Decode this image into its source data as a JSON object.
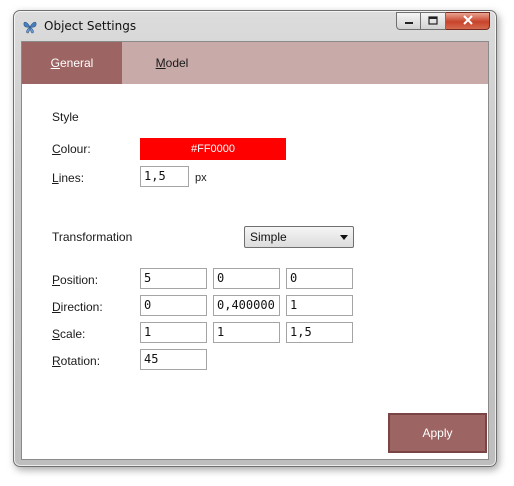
{
  "window": {
    "title": "Object Settings"
  },
  "tabs": [
    {
      "label": "General",
      "accel": "G",
      "rest": "eneral"
    },
    {
      "label": "Model",
      "accel": "M",
      "rest": "odel"
    }
  ],
  "style": {
    "heading": "Style",
    "colour": {
      "label": "Colour:",
      "accel": "C",
      "rest": "olour:",
      "value": "#FF0000"
    },
    "lines": {
      "label": "Lines:",
      "accel": "L",
      "rest": "ines:",
      "value": "1,5",
      "unit": "px"
    }
  },
  "transformation": {
    "heading": "Transformation",
    "mode_selected": "Simple",
    "position": {
      "label": "Position:",
      "accel": "P",
      "rest": "osition:",
      "values": [
        "5",
        "0",
        "0"
      ]
    },
    "direction": {
      "label": "Direction:",
      "accel": "D",
      "rest": "irection:",
      "values": [
        "0",
        "0,400000",
        "1"
      ]
    },
    "scale": {
      "label": "Scale:",
      "accel": "S",
      "rest": "cale:",
      "values": [
        "1",
        "1",
        "1,5"
      ]
    },
    "rotation": {
      "label": "Rotation:",
      "accel": "R",
      "rest": "otation:",
      "value": "45"
    }
  },
  "actions": {
    "apply_label": "Apply"
  },
  "colors": {
    "accent": "#9C6462",
    "tabbar": "#C8AAA9",
    "swatch": "#FF0000"
  },
  "icons": {
    "app": "butterfly-icon",
    "minimize": "minimize-icon",
    "maximize": "maximize-icon",
    "close": "close-icon"
  }
}
